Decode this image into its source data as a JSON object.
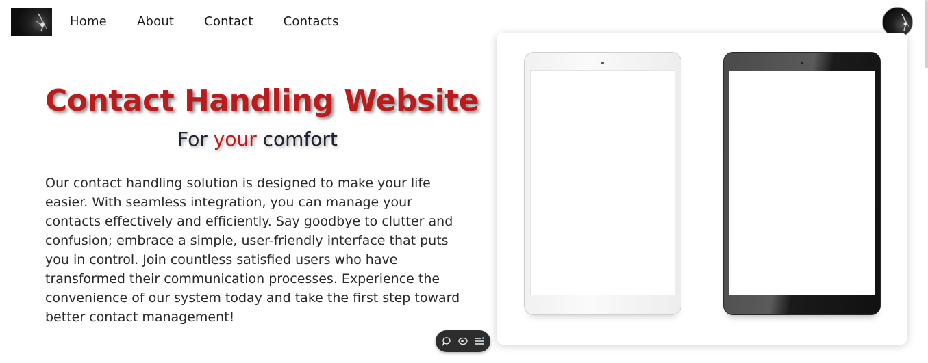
{
  "nav": {
    "logo_icon": "logo-image",
    "items": [
      {
        "label": "Home"
      },
      {
        "label": "About"
      },
      {
        "label": "Contact"
      },
      {
        "label": "Contacts"
      }
    ],
    "avatar_icon": "user-avatar"
  },
  "hero": {
    "title": "Contact Handling Website",
    "subtitle_before": "For ",
    "subtitle_accent": "your",
    "subtitle_after": " comfort",
    "body": "Our contact handling solution is designed to make your life easier. With seamless integration, you can manage your contacts effectively and efficiently. Say goodbye to clutter and confusion; embrace a simple, user-friendly interface that puts you in control. Join countless satisfied users who have transformed their communication processes. Experience the convenience of our system today and take the first step toward better contact management!"
  },
  "showcase": {
    "image": "tablet-devices-image"
  },
  "toolbar": {
    "icons": [
      "comment-icon",
      "eye-icon",
      "list-icon"
    ]
  },
  "colors": {
    "accent": "#b91c1c",
    "text": "#2a2a2a",
    "toolbar_bg": "#2d2d2d"
  }
}
